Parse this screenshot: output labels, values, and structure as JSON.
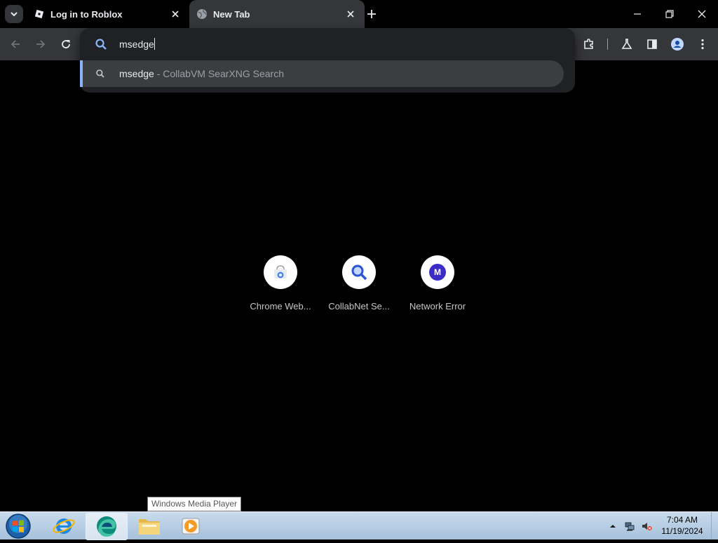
{
  "tabs": [
    {
      "title": "Log in to Roblox",
      "favicon": "roblox-icon",
      "active": false
    },
    {
      "title": "New Tab",
      "favicon": "globe-icon",
      "active": true
    }
  ],
  "omnibox": {
    "value": "msedge",
    "suggestion": {
      "query": "msedge",
      "description": " - CollabVM SearXNG Search"
    }
  },
  "shortcuts": [
    {
      "label": "Chrome Web...",
      "icon": "chrome-web-store-icon"
    },
    {
      "label": "CollabNet Se...",
      "icon": "search-magnifier-icon"
    },
    {
      "label": "Network Error",
      "icon": "letter-m-icon",
      "letter": "M"
    }
  ],
  "tooltip": "Windows Media Player",
  "taskbar": {
    "time": "7:04 AM",
    "date": "11/19/2024",
    "pinned": [
      "internet-explorer",
      "edge",
      "file-explorer",
      "windows-media-player"
    ]
  },
  "colors": {
    "accent": "#8ab4f8",
    "toolbar": "#35363a",
    "omnibox": "#202124",
    "letter_avatar": "#3b2bc7"
  }
}
